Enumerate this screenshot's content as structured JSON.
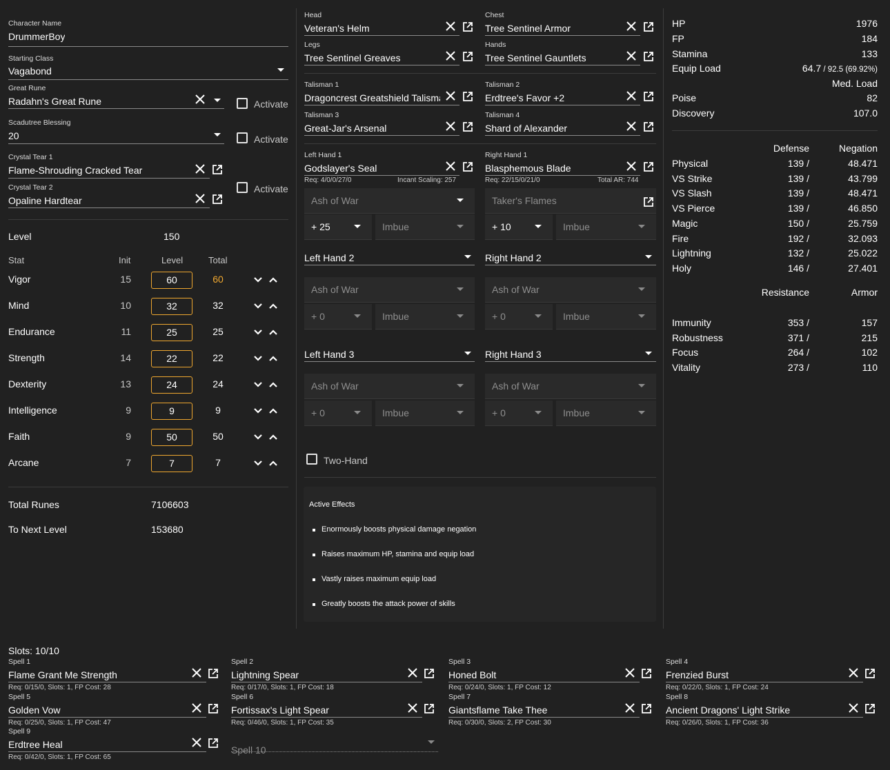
{
  "character": {
    "name_label": "Character Name",
    "name": "DrummerBoy",
    "class_label": "Starting Class",
    "class": "Vagabond",
    "great_rune_label": "Great Rune",
    "great_rune": "Radahn's Great Rune",
    "activate_label": "Activate",
    "blessing_label": "Scadutree Blessing",
    "blessing": "20",
    "tear1_label": "Crystal Tear 1",
    "tear1": "Flame-Shrouding Cracked Tear",
    "tear2_label": "Crystal Tear 2",
    "tear2": "Opaline Hardtear"
  },
  "level": {
    "label": "Level",
    "value": "150"
  },
  "stats_header": {
    "stat": "Stat",
    "init": "Init",
    "level": "Level",
    "total": "Total"
  },
  "stats": [
    {
      "name": "Vigor",
      "init": "15",
      "level": "60",
      "total": "60"
    },
    {
      "name": "Mind",
      "init": "10",
      "level": "32",
      "total": "32"
    },
    {
      "name": "Endurance",
      "init": "11",
      "level": "25",
      "total": "25"
    },
    {
      "name": "Strength",
      "init": "14",
      "level": "22",
      "total": "22"
    },
    {
      "name": "Dexterity",
      "init": "13",
      "level": "24",
      "total": "24"
    },
    {
      "name": "Intelligence",
      "init": "9",
      "level": "9",
      "total": "9"
    },
    {
      "name": "Faith",
      "init": "9",
      "level": "50",
      "total": "50"
    },
    {
      "name": "Arcane",
      "init": "7",
      "level": "7",
      "total": "7"
    }
  ],
  "runes": {
    "total_label": "Total Runes",
    "total": "7106603",
    "next_label": "To Next Level",
    "next": "153680"
  },
  "armor": {
    "head_label": "Head",
    "head": "Veteran's Helm",
    "chest_label": "Chest",
    "chest": "Tree Sentinel Armor",
    "legs_label": "Legs",
    "legs": "Tree Sentinel Greaves",
    "hands_label": "Hands",
    "hands": "Tree Sentinel Gauntlets"
  },
  "talismans": {
    "t1_label": "Talisman 1",
    "t1": "Dragoncrest Greatshield Talisman",
    "t2_label": "Talisman 2",
    "t2": "Erdtree's Favor +2",
    "t3_label": "Talisman 3",
    "t3": "Great-Jar's Arsenal",
    "t4_label": "Talisman 4",
    "t4": "Shard of Alexander"
  },
  "weapons": {
    "lh1_label": "Left Hand 1",
    "lh1": "Godslayer's Seal",
    "lh1_req": "Req: 4/0/0/27/0",
    "lh1_scaling": "Incant Scaling: 257",
    "rh1_label": "Right Hand 1",
    "rh1": "Blasphemous Blade",
    "rh1_req": "Req: 22/15/0/21/0",
    "rh1_ar": "Total AR: 744",
    "ash_of_war": "Ash of War",
    "takers_flames": "Taker's Flames",
    "lh1_upgrade": "+ 25",
    "rh1_upgrade": "+ 10",
    "imbue": "Imbue",
    "zero_upgrade": "+ 0",
    "lh2": "Left Hand 2",
    "rh2": "Right Hand 2",
    "lh3": "Left Hand 3",
    "rh3": "Right Hand 3",
    "two_hand": "Two-Hand"
  },
  "effects": {
    "title": "Active Effects",
    "items": [
      "Enormously boosts physical damage negation",
      "Raises maximum HP, stamina and equip load",
      "Vastly raises maximum equip load",
      "Greatly boosts the attack power of skills"
    ]
  },
  "summary": {
    "hp_label": "HP",
    "hp": "1976",
    "fp_label": "FP",
    "fp": "184",
    "stamina_label": "Stamina",
    "stamina": "133",
    "equip_label": "Equip Load",
    "equip_main": "64.7",
    "equip_rest": " / 92.5 (69.92%)",
    "load_class": "Med. Load",
    "poise_label": "Poise",
    "poise": "82",
    "discovery_label": "Discovery",
    "discovery": "107.0"
  },
  "defense_header": {
    "defense": "Defense",
    "negation": "Negation"
  },
  "defense": [
    {
      "name": "Physical",
      "def": "139 /",
      "neg": "48.471"
    },
    {
      "name": "VS Strike",
      "def": "139 /",
      "neg": "43.799"
    },
    {
      "name": "VS Slash",
      "def": "139 /",
      "neg": "48.471"
    },
    {
      "name": "VS Pierce",
      "def": "139 /",
      "neg": "46.850"
    },
    {
      "name": "Magic",
      "def": "150 /",
      "neg": "25.759"
    },
    {
      "name": "Fire",
      "def": "192 /",
      "neg": "32.093"
    },
    {
      "name": "Lightning",
      "def": "132 /",
      "neg": "25.022"
    },
    {
      "name": "Holy",
      "def": "146 /",
      "neg": "27.401"
    }
  ],
  "resist_header": {
    "resistance": "Resistance",
    "armor": "Armor"
  },
  "resistance": [
    {
      "name": "Immunity",
      "res": "353 /",
      "armor": "157"
    },
    {
      "name": "Robustness",
      "res": "371 /",
      "armor": "215"
    },
    {
      "name": "Focus",
      "res": "264 /",
      "armor": "102"
    },
    {
      "name": "Vitality",
      "res": "273 /",
      "armor": "110"
    }
  ],
  "spells": {
    "slots": "Slots: 10/10",
    "items": [
      {
        "label": "Spell 1",
        "name": "Flame Grant Me Strength",
        "req": "Req: 0/15/0, Slots: 1, FP Cost: 28"
      },
      {
        "label": "Spell 2",
        "name": "Lightning Spear",
        "req": "Req: 0/17/0, Slots: 1, FP Cost: 18"
      },
      {
        "label": "Spell 3",
        "name": "Honed Bolt",
        "req": "Req: 0/24/0, Slots: 1, FP Cost: 12"
      },
      {
        "label": "Spell 4",
        "name": "Frenzied Burst",
        "req": "Req: 0/22/0, Slots: 1, FP Cost: 24"
      },
      {
        "label": "Spell 5",
        "name": "Golden Vow",
        "req": "Req: 0/25/0, Slots: 1, FP Cost: 47"
      },
      {
        "label": "Spell 6",
        "name": "Fortissax's Light Spear",
        "req": "Req: 0/46/0, Slots: 1, FP Cost: 35"
      },
      {
        "label": "Spell 7",
        "name": "Giantsflame Take Thee",
        "req": "Req: 0/30/0, Slots: 2, FP Cost: 30"
      },
      {
        "label": "Spell 8",
        "name": "Ancient Dragons' Light Strike",
        "req": "Req: 0/26/0, Slots: 1, FP Cost: 36"
      },
      {
        "label": "Spell 9",
        "name": "Erdtree Heal",
        "req": "Req: 0/42/0, Slots: 1, FP Cost: 65"
      }
    ],
    "spell10": "Spell 10"
  },
  "icons": {
    "clear": "close-icon",
    "open": "open-in-new-icon",
    "dropdown": "chevron-down-icon",
    "decrease": "chevron-down-icon",
    "increase": "chevron-up-icon"
  },
  "colors": {
    "background": "#212121",
    "accent": "#f0a830"
  }
}
